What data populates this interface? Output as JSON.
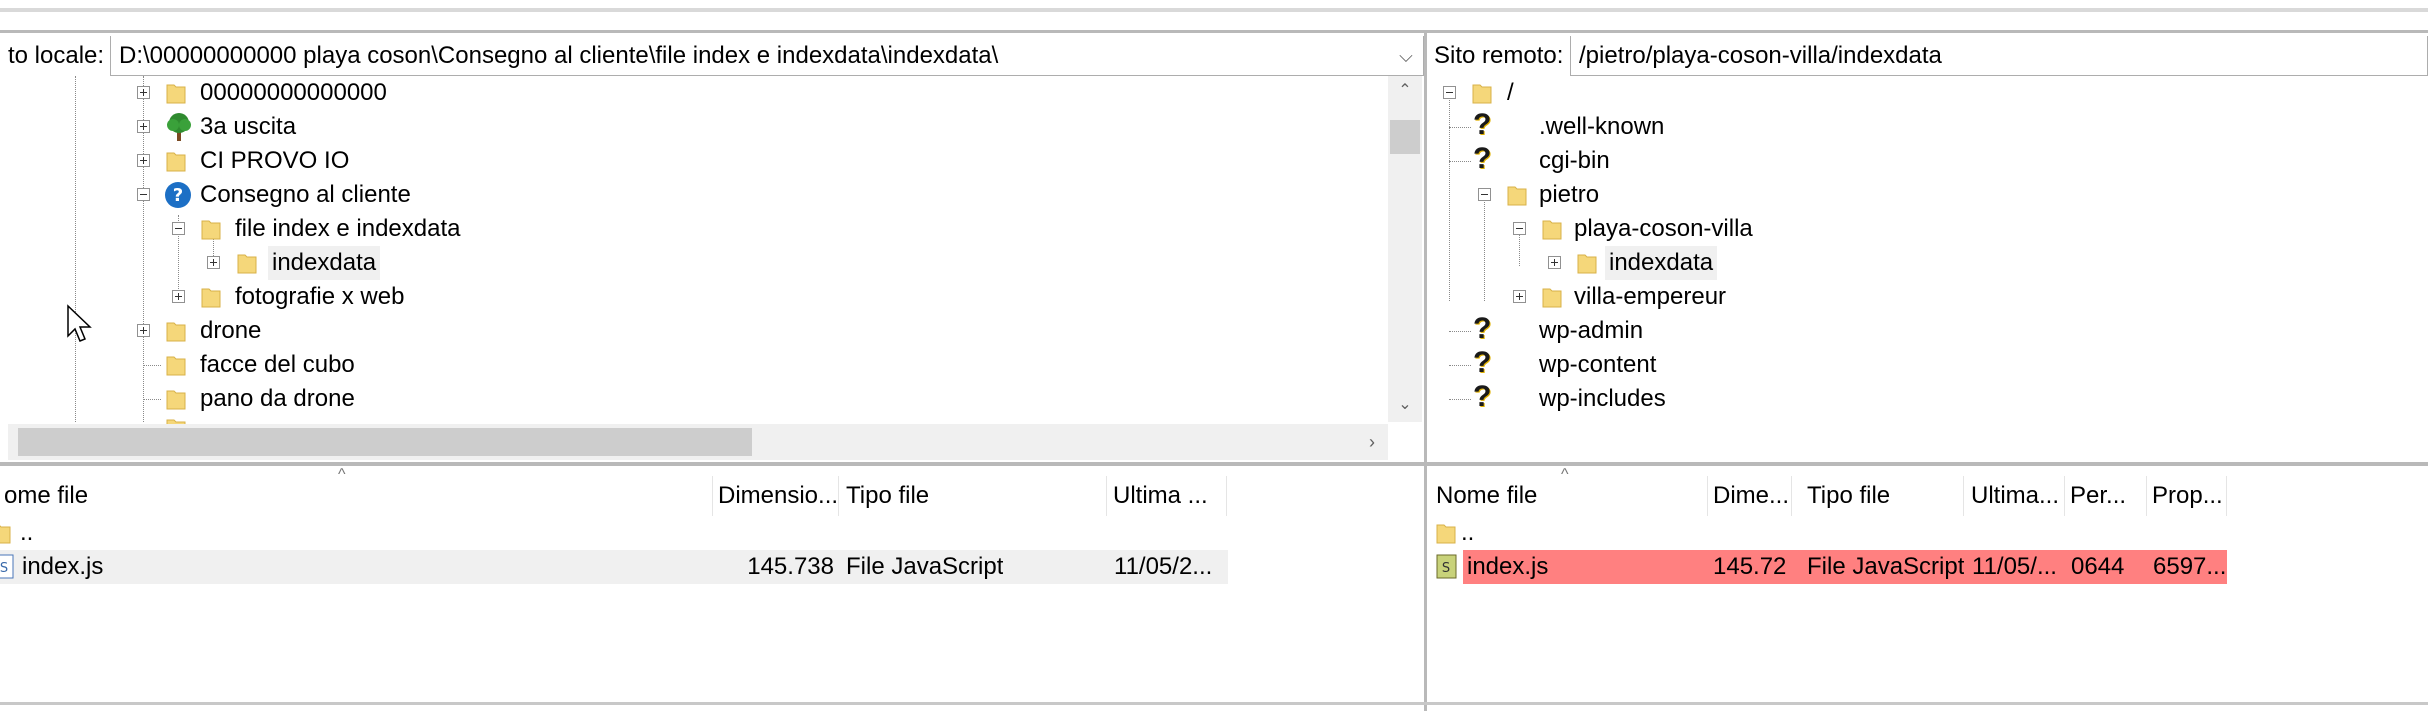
{
  "colors": {
    "highlight": "#ff8080",
    "selected_row": "#f0f0f0",
    "folder": "#f5d77a",
    "question": "#1c6fc5"
  },
  "local": {
    "label": "to locale:",
    "path": "D:\\00000000000 playa coson\\Consegno al cliente\\file index e indexdata\\indexdata\\",
    "tree": [
      {
        "label": "00000000000000",
        "icon": "folder-icon"
      },
      {
        "label": "3a uscita",
        "icon": "tree-icon"
      },
      {
        "label": "CI PROVO IO",
        "icon": "folder-icon"
      },
      {
        "label": "Consegno al cliente",
        "icon": "question-circle-icon"
      },
      {
        "label": "file index e indexdata",
        "icon": "folder-icon"
      },
      {
        "label": "indexdata",
        "icon": "folder-icon"
      },
      {
        "label": "fotografie x web",
        "icon": "folder-icon"
      },
      {
        "label": "drone",
        "icon": "folder-icon"
      },
      {
        "label": "facce del cubo",
        "icon": "folder-icon"
      },
      {
        "label": "pano da drone",
        "icon": "folder-icon"
      }
    ],
    "columns": {
      "name": "ome file",
      "size": "Dimensio...",
      "type": "Tipo file",
      "modified": "Ultima ..."
    },
    "files": [
      {
        "name": "..",
        "size": "",
        "type": "",
        "modified": ""
      },
      {
        "name": "index.js",
        "size": "145.738",
        "type": "File JavaScript",
        "modified": "11/05/2..."
      }
    ]
  },
  "remote": {
    "label": "Sito remoto:",
    "path": "/pietro/playa-coson-villa/indexdata",
    "tree": [
      {
        "label": "/",
        "icon": "folder-icon"
      },
      {
        "label": ".well-known",
        "icon": "question-mark-icon"
      },
      {
        "label": "cgi-bin",
        "icon": "question-mark-icon"
      },
      {
        "label": "pietro",
        "icon": "folder-icon"
      },
      {
        "label": "playa-coson-villa",
        "icon": "folder-icon"
      },
      {
        "label": "indexdata",
        "icon": "folder-icon"
      },
      {
        "label": "villa-empereur",
        "icon": "folder-icon"
      },
      {
        "label": "wp-admin",
        "icon": "question-mark-icon"
      },
      {
        "label": "wp-content",
        "icon": "question-mark-icon"
      },
      {
        "label": "wp-includes",
        "icon": "question-mark-icon"
      }
    ],
    "columns": {
      "name": "Nome file",
      "size": "Dime...",
      "type": "Tipo file",
      "modified": "Ultima...",
      "perms": "Per...",
      "owner": "Prop..."
    },
    "files": [
      {
        "name": "..",
        "size": "",
        "type": "",
        "modified": "",
        "perms": "",
        "owner": ""
      },
      {
        "name": "index.js",
        "size": "145.723",
        "type": "File JavaScript",
        "modified": "11/05/...",
        "perms": "0644",
        "owner": "6597..."
      }
    ]
  }
}
